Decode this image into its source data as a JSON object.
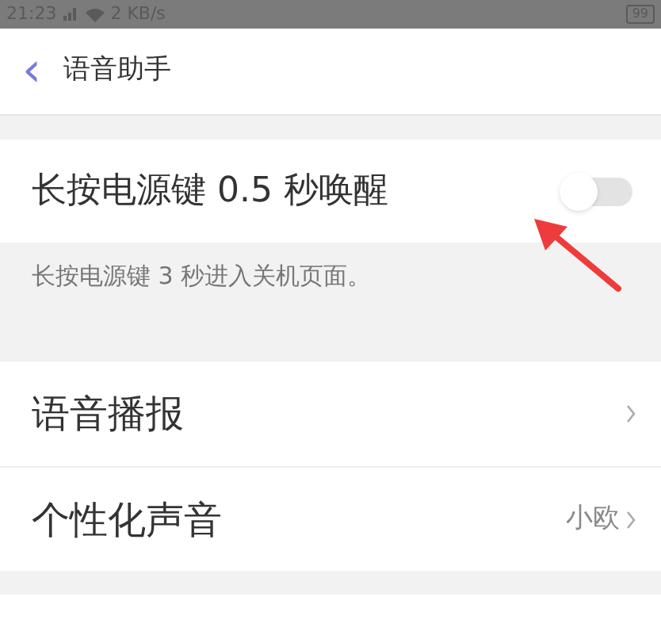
{
  "status_bar": {
    "time": "21:23",
    "speed": "2 KB/s",
    "battery": "99"
  },
  "header": {
    "back": "‹",
    "title": "语音助手"
  },
  "wake_setting": {
    "label": "长按电源键 0.5 秒唤醒",
    "on": false,
    "description": "长按电源键 3 秒进入关机页面。"
  },
  "items": [
    {
      "label": "语音播报",
      "value": null
    },
    {
      "label": "个性化声音",
      "value": "小欧"
    }
  ]
}
